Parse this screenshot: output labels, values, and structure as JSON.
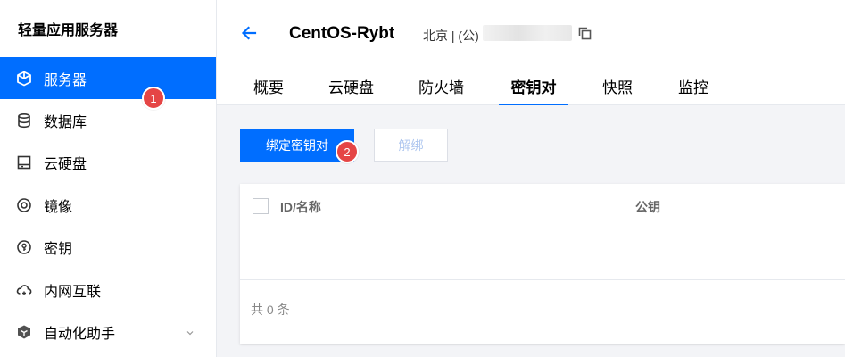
{
  "sidebar": {
    "title": "轻量应用服务器",
    "items": [
      {
        "label": "服务器",
        "icon": "cube-icon",
        "active": true
      },
      {
        "label": "数据库",
        "icon": "database-icon"
      },
      {
        "label": "云硬盘",
        "icon": "disk-icon"
      },
      {
        "label": "镜像",
        "icon": "image-icon"
      },
      {
        "label": "密钥",
        "icon": "key-icon"
      },
      {
        "label": "内网互联",
        "icon": "link-icon"
      },
      {
        "label": "自动化助手",
        "icon": "automation-icon"
      }
    ]
  },
  "annotations": {
    "badge1": "1",
    "badge2": "2"
  },
  "header": {
    "server_name": "CentOS-Rybt",
    "region": "北京 | (公)"
  },
  "tabs": [
    {
      "label": "概要"
    },
    {
      "label": "云硬盘"
    },
    {
      "label": "防火墙"
    },
    {
      "label": "密钥对",
      "active": true
    },
    {
      "label": "快照"
    },
    {
      "label": "监控"
    }
  ],
  "toolbar": {
    "bind_label": "绑定密钥对",
    "unbind_label": "解绑"
  },
  "table": {
    "columns": [
      "ID/名称",
      "公钥"
    ],
    "rows": [],
    "footer": "共 0 条"
  },
  "colors": {
    "accent": "#006eff",
    "badge": "#e54545"
  }
}
